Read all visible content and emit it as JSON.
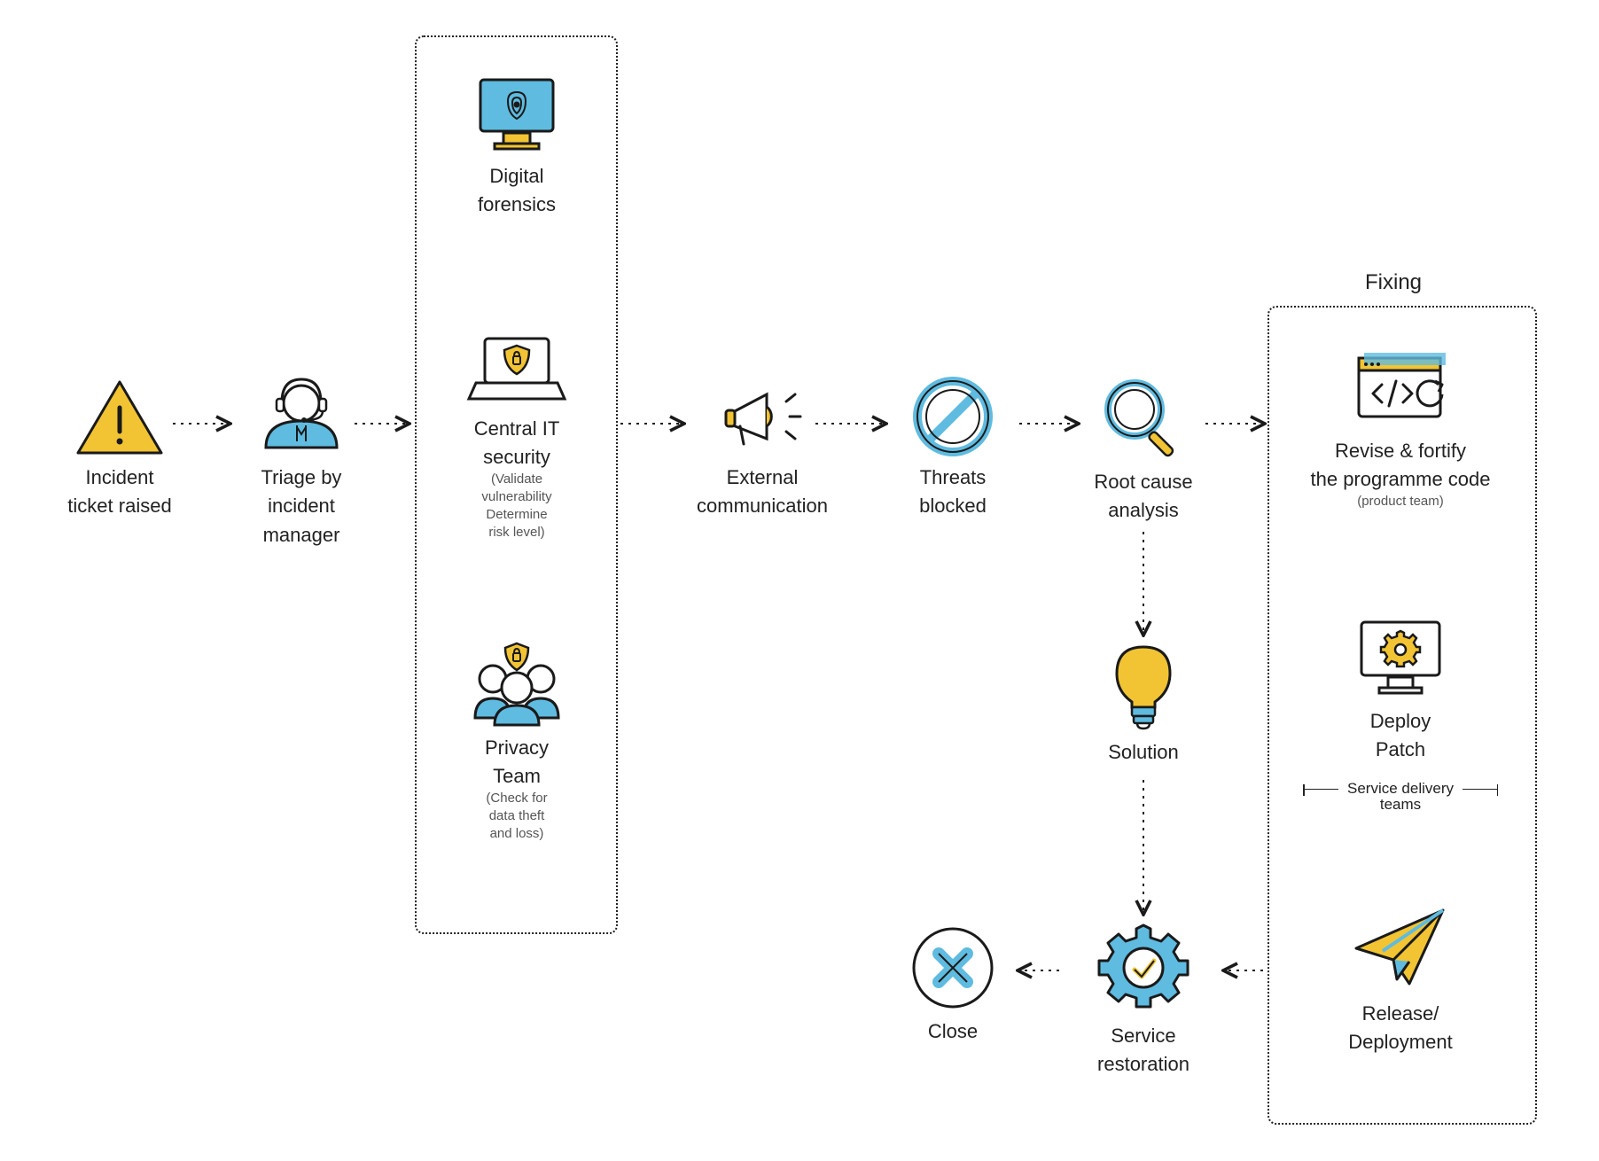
{
  "colors": {
    "yellow": "#F2C433",
    "blue": "#5FBBE0",
    "ink": "#1A1A1A",
    "grey": "#8E8E8E"
  },
  "nodes": {
    "incident": {
      "label1": "Incident",
      "label2": "ticket raised"
    },
    "triage": {
      "label1": "Triage by",
      "label2": "incident",
      "label3": "manager"
    },
    "forensics": {
      "label1": "Digital",
      "label2": "forensics"
    },
    "central": {
      "label1": "Central IT",
      "label2": "security",
      "sub1": "(Validate",
      "sub2": "vulnerability",
      "sub3": "Determine",
      "sub4": "risk level)"
    },
    "privacy": {
      "label1": "Privacy",
      "label2": "Team",
      "sub1": "(Check for",
      "sub2": "data theft",
      "sub3": "and loss)"
    },
    "external": {
      "label1": "External",
      "label2": "communication"
    },
    "threats": {
      "label1": "Threats",
      "label2": "blocked"
    },
    "root": {
      "label1": "Root cause",
      "label2": "analysis"
    },
    "solution": {
      "label1": "Solution"
    },
    "restore": {
      "label1": "Service",
      "label2": "restoration"
    },
    "close": {
      "label1": "Close"
    },
    "revise": {
      "label1": "Revise & fortify",
      "label2": "the programme code",
      "sub1": "(product team)"
    },
    "deploy": {
      "label1": "Deploy",
      "label2": "Patch"
    },
    "release": {
      "label1": "Release/",
      "label2": "Deployment"
    }
  },
  "groups": {
    "teams": {
      "title": ""
    },
    "fixing": {
      "title": "Fixing"
    }
  },
  "divider": {
    "text": "Service delivery",
    "text2": "teams"
  }
}
